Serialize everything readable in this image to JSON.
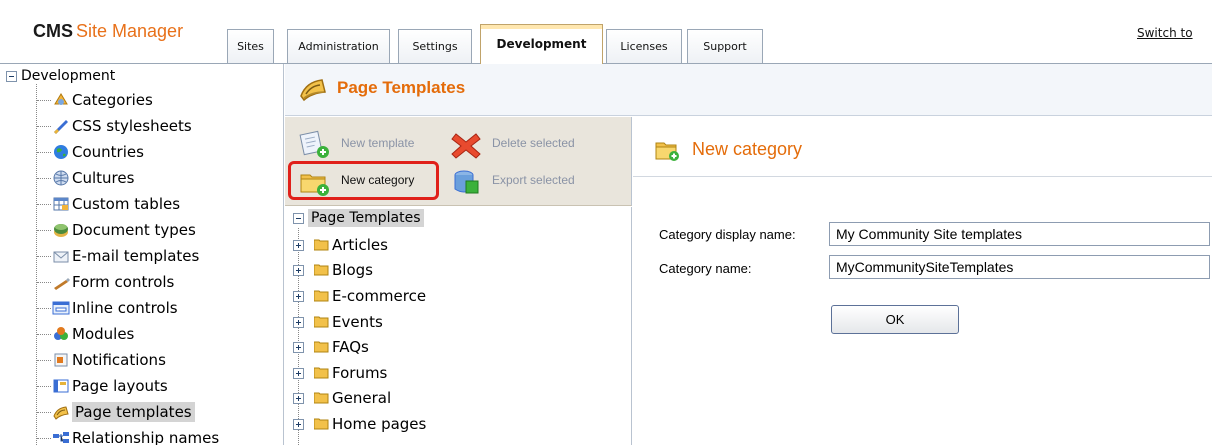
{
  "header": {
    "brand_cms": "CMS",
    "brand_site": "Site Manager",
    "tabs": [
      "Sites",
      "Administration",
      "Settings",
      "Development",
      "Licenses",
      "Support"
    ],
    "active_tab": "Development",
    "switch_to": "Switch to"
  },
  "left_tree": {
    "root": "Development",
    "items": [
      "Categories",
      "CSS stylesheets",
      "Countries",
      "Cultures",
      "Custom tables",
      "Document types",
      "E-mail templates",
      "Form controls",
      "Inline controls",
      "Modules",
      "Notifications",
      "Page layouts",
      "Page templates",
      "Relationship names"
    ],
    "selected": "Page templates"
  },
  "page_templates": {
    "title": "Page Templates",
    "actions": {
      "new_template": "New template",
      "delete_selected": "Delete selected",
      "new_category": "New category",
      "export_selected": "Export selected"
    },
    "tree": {
      "root": "Page Templates",
      "items": [
        "Articles",
        "Blogs",
        "E-commerce",
        "Events",
        "FAQs",
        "Forums",
        "General",
        "Home pages"
      ]
    }
  },
  "form": {
    "title": "New category",
    "display_name_label": "Category display name:",
    "display_name_value": "My Community Site templates",
    "name_label": "Category name:",
    "name_value": "MyCommunitySiteTemplates",
    "ok_label": "OK"
  },
  "colors": {
    "accent_orange": "#e46c0a",
    "highlight_red": "#e0201a",
    "toolbar_bg": "#e9e5dc"
  }
}
